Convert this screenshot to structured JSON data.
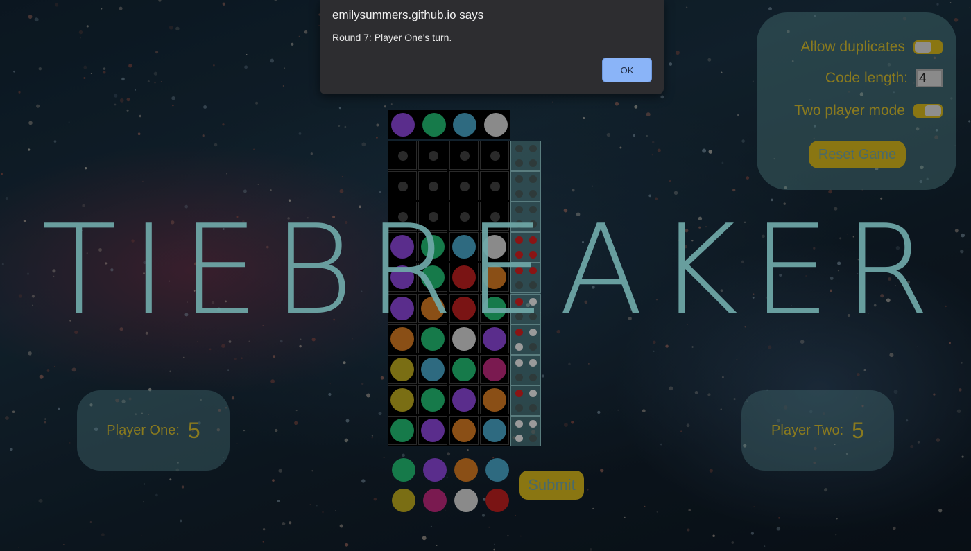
{
  "dialog": {
    "host": "emilysummers.github.io says",
    "message": "Round 7: Player One's turn.",
    "ok_label": "OK"
  },
  "settings": {
    "allow_duplicates_label": "Allow duplicates",
    "allow_duplicates_on": false,
    "code_length_label": "Code length:",
    "code_length_value": "4",
    "two_player_label": "Two player mode",
    "two_player_on": true,
    "reset_label": "Reset Game"
  },
  "title": "TIEBREAKER",
  "scores": {
    "player_one_label": "Player One:",
    "player_one_value": "5",
    "player_two_label": "Player Two:",
    "player_two_value": "5"
  },
  "submit_label": "Submit",
  "colors": {
    "purple": "#5a2d8c",
    "green": "#167a4a",
    "teal": "#2e6a80",
    "gray": "#8a8a8a",
    "orange": "#8a4f16",
    "red": "#7a1414",
    "olive": "#7a6e14",
    "magenta": "#7a1a50",
    "empty": "#2a2a2a",
    "fb_red": "#8a1414",
    "fb_white": "#9a9a9a",
    "fb_empty": "#2e3a3a"
  },
  "board": {
    "secret": [
      "purple",
      "green",
      "teal",
      "gray"
    ],
    "rows": [
      {
        "pegs": [
          "empty",
          "empty",
          "empty",
          "empty"
        ],
        "feedback": [
          "fb_empty",
          "fb_empty",
          "fb_empty",
          "fb_empty"
        ]
      },
      {
        "pegs": [
          "empty",
          "empty",
          "empty",
          "empty"
        ],
        "feedback": [
          "fb_empty",
          "fb_empty",
          "fb_empty",
          "fb_empty"
        ]
      },
      {
        "pegs": [
          "empty",
          "empty",
          "empty",
          "empty"
        ],
        "feedback": [
          "fb_empty",
          "fb_empty",
          "fb_empty",
          "fb_empty"
        ]
      },
      {
        "pegs": [
          "purple",
          "green",
          "teal",
          "gray"
        ],
        "feedback": [
          "fb_red",
          "fb_red",
          "fb_red",
          "fb_red"
        ]
      },
      {
        "pegs": [
          "purple",
          "green",
          "red",
          "orange"
        ],
        "feedback": [
          "fb_red",
          "fb_red",
          "fb_empty",
          "fb_empty"
        ]
      },
      {
        "pegs": [
          "purple",
          "orange",
          "red",
          "green"
        ],
        "feedback": [
          "fb_red",
          "fb_white",
          "fb_empty",
          "fb_empty"
        ]
      },
      {
        "pegs": [
          "orange",
          "green",
          "gray",
          "purple"
        ],
        "feedback": [
          "fb_red",
          "fb_white",
          "fb_white",
          "fb_empty"
        ]
      },
      {
        "pegs": [
          "olive",
          "teal",
          "green",
          "magenta"
        ],
        "feedback": [
          "fb_white",
          "fb_white",
          "fb_empty",
          "fb_empty"
        ]
      },
      {
        "pegs": [
          "olive",
          "green",
          "purple",
          "orange"
        ],
        "feedback": [
          "fb_red",
          "fb_white",
          "fb_empty",
          "fb_empty"
        ]
      },
      {
        "pegs": [
          "green",
          "purple",
          "orange",
          "teal"
        ],
        "feedback": [
          "fb_white",
          "fb_white",
          "fb_white",
          "fb_empty"
        ]
      }
    ],
    "palette": [
      "green",
      "purple",
      "orange",
      "teal",
      "olive",
      "magenta",
      "gray",
      "red"
    ]
  }
}
